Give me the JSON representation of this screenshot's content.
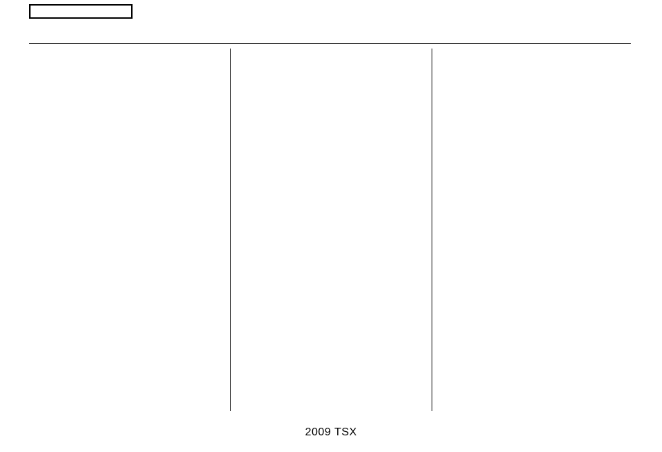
{
  "footer": {
    "text": "2009 TSX"
  }
}
